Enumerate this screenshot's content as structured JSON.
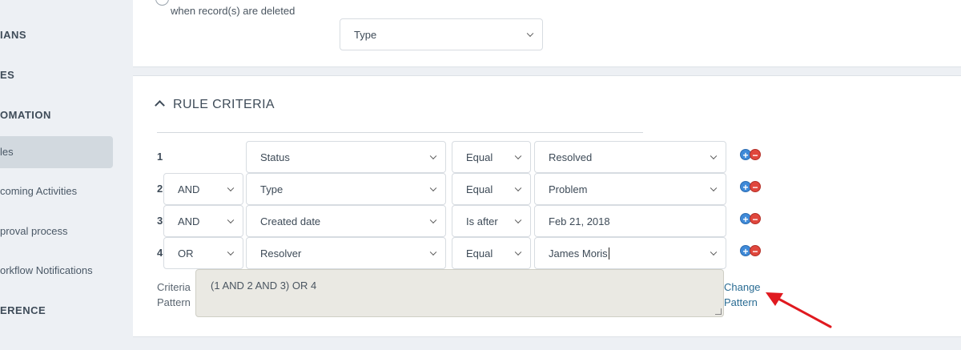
{
  "sidebar": {
    "items": [
      {
        "label": "IANS",
        "type": "section"
      },
      {
        "label": "ES",
        "type": "section"
      },
      {
        "label": "OMATION",
        "type": "section"
      },
      {
        "label": "les",
        "type": "item",
        "active": true
      },
      {
        "label": "coming Activities",
        "type": "item"
      },
      {
        "label": "proval process",
        "type": "item"
      },
      {
        "label": "orkflow Notifications",
        "type": "item"
      },
      {
        "label": "ERENCE",
        "type": "section"
      }
    ]
  },
  "top_panel": {
    "note": "when record(s) are deleted",
    "type_select": "Type"
  },
  "rule_criteria": {
    "title": "RULE CRITERIA",
    "rows": [
      {
        "num": "1",
        "connector": "",
        "field": "Status",
        "operator": "Equal",
        "value": "Resolved",
        "value_is_select": true
      },
      {
        "num": "2",
        "connector": "AND",
        "field": "Type",
        "operator": "Equal",
        "value": "Problem",
        "value_is_select": true
      },
      {
        "num": "3",
        "connector": "AND",
        "field": "Created date",
        "operator": "Is after",
        "value": "Feb 21, 2018",
        "value_is_select": false
      },
      {
        "num": "4",
        "connector": "OR",
        "field": "Resolver",
        "operator": "Equal",
        "value": "James Moris",
        "value_is_select": true
      }
    ],
    "criteria_label_line1": "Criteria",
    "criteria_label_line2": "Pattern",
    "criteria_pattern": "(1 AND 2 AND 3) OR 4",
    "change_pattern_line1": "Change",
    "change_pattern_line2": "Pattern"
  },
  "colors": {
    "sidebar_bg": "#edf0f4",
    "active_item_bg": "#d2d9df",
    "link": "#2a6c93",
    "add_icon": "#3f8ad8",
    "remove_icon": "#e0473d",
    "annotation_arrow": "#e0191f"
  },
  "icons": {
    "add": "plus-circle-icon",
    "remove": "minus-circle-icon",
    "collapse": "chevron-up-icon",
    "dropdown": "chevron-down-icon"
  }
}
